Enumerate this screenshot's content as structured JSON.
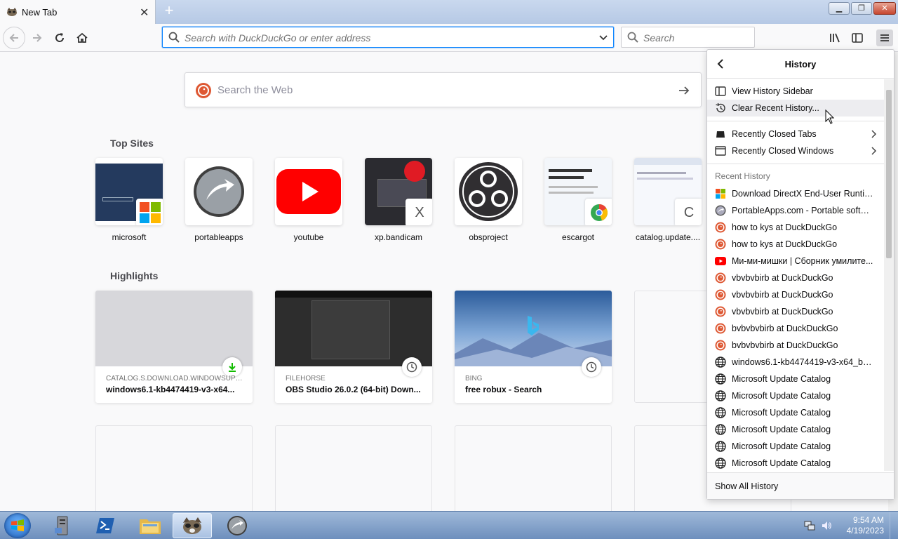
{
  "tab": {
    "title": "New Tab"
  },
  "urlbar": {
    "placeholder": "Search with DuckDuckGo or enter address"
  },
  "searchbar": {
    "placeholder": "Search"
  },
  "websearch": {
    "placeholder": "Search the Web"
  },
  "top_sites": {
    "title": "Top Sites",
    "items": [
      {
        "label": "microsoft"
      },
      {
        "label": "portableapps"
      },
      {
        "label": "youtube"
      },
      {
        "label": "xp.bandicam",
        "badge": "X"
      },
      {
        "label": "obsproject"
      },
      {
        "label": "escargot"
      },
      {
        "label": "catalog.update....",
        "badge": "C"
      }
    ]
  },
  "highlights": {
    "title": "Highlights",
    "items": [
      {
        "source": "CATALOG.S.DOWNLOAD.WINDOWSUPDA...",
        "title": "windows6.1-kb4474419-v3-x64...",
        "kind": "download"
      },
      {
        "source": "FILEHORSE",
        "title": "OBS Studio 26.0.2 (64-bit) Down...",
        "kind": "history"
      },
      {
        "source": "BING",
        "title": "free robux - Search",
        "kind": "history"
      }
    ]
  },
  "history_panel": {
    "title": "History",
    "view_sidebar": "View History Sidebar",
    "clear_recent": "Clear Recent History...",
    "recently_closed_tabs": "Recently Closed Tabs",
    "recently_closed_windows": "Recently Closed Windows",
    "recent_header": "Recent History",
    "recent": [
      {
        "text": "Download DirectX End-User Runtime...",
        "icon": "microsoft-icon"
      },
      {
        "text": "PortableApps.com - Portable softwa...",
        "icon": "portableapps-icon"
      },
      {
        "text": "how to kys at DuckDuckGo",
        "icon": "duckduckgo-icon"
      },
      {
        "text": "how to kys at DuckDuckGo",
        "icon": "duckduckgo-icon"
      },
      {
        "text": "Ми-ми-мишки | Сборник умилите...",
        "icon": "youtube-icon"
      },
      {
        "text": "vbvbvbirb at DuckDuckGo",
        "icon": "duckduckgo-icon"
      },
      {
        "text": "vbvbvbirb at DuckDuckGo",
        "icon": "duckduckgo-icon"
      },
      {
        "text": "vbvbvbirb at DuckDuckGo",
        "icon": "duckduckgo-icon"
      },
      {
        "text": "bvbvbvbirb at DuckDuckGo",
        "icon": "duckduckgo-icon"
      },
      {
        "text": "bvbvbvbirb at DuckDuckGo",
        "icon": "duckduckgo-icon"
      },
      {
        "text": "windows6.1-kb4474419-v3-x64_b561...",
        "icon": "globe-icon"
      },
      {
        "text": "Microsoft Update Catalog",
        "icon": "globe-icon"
      },
      {
        "text": "Microsoft Update Catalog",
        "icon": "globe-icon"
      },
      {
        "text": "Microsoft Update Catalog",
        "icon": "globe-icon"
      },
      {
        "text": "Microsoft Update Catalog",
        "icon": "globe-icon"
      },
      {
        "text": "Microsoft Update Catalog",
        "icon": "globe-icon"
      },
      {
        "text": "Microsoft Update Catalog",
        "icon": "globe-icon"
      }
    ],
    "show_all": "Show All History"
  },
  "taskbar": {
    "time": "9:54 AM",
    "date": "4/19/2023"
  },
  "colors": {
    "accent": "#0a84ff",
    "ddg": "#de5833",
    "youtube": "#ff0000"
  }
}
